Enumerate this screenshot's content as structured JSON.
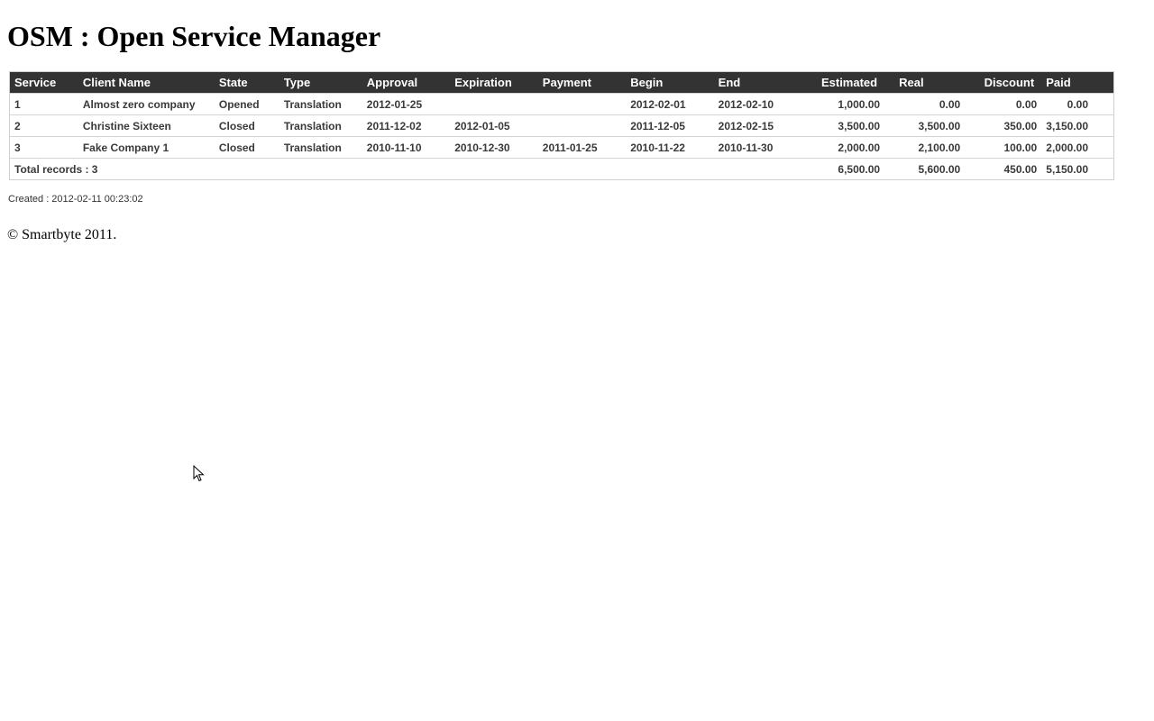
{
  "page": {
    "title": "OSM : Open Service Manager"
  },
  "table": {
    "columns": [
      "Service",
      "Client Name",
      "State",
      "Type",
      "Approval",
      "Expiration",
      "Payment",
      "Begin",
      "End",
      "Estimated",
      "Real",
      "Discount",
      "Paid"
    ],
    "rows": [
      {
        "service": "1",
        "client": "Almost zero company",
        "state": "Opened",
        "type": "Translation",
        "approval": "2012-01-25",
        "expiration": "",
        "payment": "",
        "begin": "2012-02-01",
        "end": "2012-02-10",
        "estimated": "1,000.00",
        "real": "0.00",
        "discount": "0.00",
        "paid": "0.00"
      },
      {
        "service": "2",
        "client": "Christine Sixteen",
        "state": "Closed",
        "type": "Translation",
        "approval": "2011-12-02",
        "expiration": "2012-01-05",
        "payment": "",
        "begin": "2011-12-05",
        "end": "2012-02-15",
        "estimated": "3,500.00",
        "real": "3,500.00",
        "discount": "350.00",
        "paid": "3,150.00"
      },
      {
        "service": "3",
        "client": "Fake Company 1",
        "state": "Closed",
        "type": "Translation",
        "approval": "2010-11-10",
        "expiration": "2010-12-30",
        "payment": "2011-01-25",
        "begin": "2010-11-22",
        "end": "2010-11-30",
        "estimated": "2,000.00",
        "real": "2,100.00",
        "discount": "100.00",
        "paid": "2,000.00"
      }
    ],
    "totals": {
      "label": "Total records : 3",
      "estimated": "6,500.00",
      "real": "5,600.00",
      "discount": "450.00",
      "paid": "5,150.00"
    },
    "header_bg": "#333333"
  },
  "footer": {
    "created": "Created : 2012-02-11 00:23:02",
    "copyright": "© Smartbyte 2011."
  }
}
